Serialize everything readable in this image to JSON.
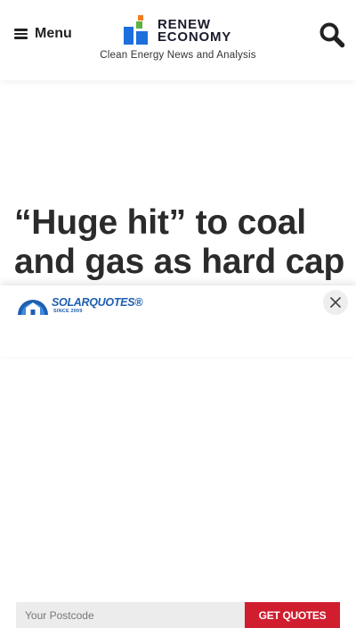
{
  "header": {
    "menu_label": "Menu",
    "logo": {
      "line1": "RENEW",
      "line2": "ECONOMY"
    },
    "tagline": "Clean Energy News and Analysis",
    "icons": {
      "menu": "hamburger-icon",
      "search": "search-icon"
    }
  },
  "article": {
    "headline": "“Huge hit” to coal and gas as hard cap and"
  },
  "promo": {
    "brand": "SOLARQUOTES",
    "trademark": "®",
    "since": "SINCE 2009",
    "postcode_placeholder": "Your Postcode",
    "postcode_value": "",
    "button_label": "GET QUOTES",
    "icons": {
      "close": "close-icon",
      "logo": "solar-house-icon"
    }
  },
  "colors": {
    "renew_blue": "#1d6fdc",
    "renew_navy": "#1a1a2e",
    "renew_orange": "#f47b20",
    "renew_green": "#5fb142",
    "solarquotes_blue": "#1d5fb0",
    "cta_red": "#d01e2f"
  }
}
